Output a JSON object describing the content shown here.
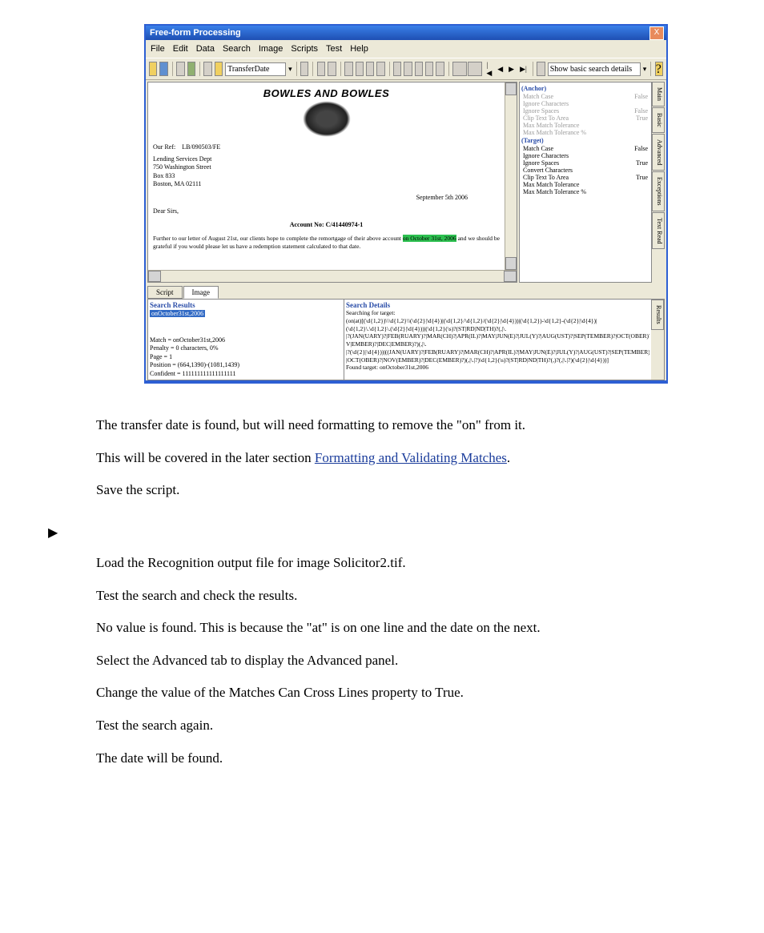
{
  "window": {
    "title": "Free-form Processing",
    "close": "X"
  },
  "menu": [
    "File",
    "Edit",
    "Data",
    "Search",
    "Image",
    "Scripts",
    "Test",
    "Help"
  ],
  "toolbar": {
    "field": "TransferDate",
    "showDetail": "Show basic search details"
  },
  "doc": {
    "company": "BOWLES AND BOWLES",
    "ourref_label": "Our Ref:",
    "ourref": "LB/090503/FE",
    "addr1": "Lending Services Dept",
    "addr2": "750 Washington Street",
    "addr3": "Box 833",
    "addr4": "Boston, MA 02111",
    "date": "September 5th 2006",
    "dear": "Dear Sirs,",
    "acct": "Account No:  C/41440974-1",
    "para_pre": "Further to our letter of August 21st, our clients hope to complete the remortgage of their above account ",
    "para_hl": "on October 31st, 2006",
    "para_post": " and we should be grateful if you would please let us have a redemption statement calculated to that date."
  },
  "props": {
    "grp1": "(Anchor)",
    "rows1": [
      {
        "k": "Match Case",
        "v": "False"
      },
      {
        "k": "Ignore Characters",
        "v": ""
      },
      {
        "k": "Ignore Spaces",
        "v": "False"
      },
      {
        "k": "Clip Text To Area",
        "v": "True"
      },
      {
        "k": "Max Match Tolerance",
        "v": ""
      },
      {
        "k": "Max Match Tolerance %",
        "v": ""
      }
    ],
    "grp2": "(Target)",
    "rows2": [
      {
        "k": "Match Case",
        "v": "False"
      },
      {
        "k": "Ignore Characters",
        "v": ""
      },
      {
        "k": "Ignore Spaces",
        "v": "True"
      },
      {
        "k": "Convert Characters",
        "v": ""
      },
      {
        "k": "Clip Text To Area",
        "v": "True"
      },
      {
        "k": "Max Match Tolerance",
        "v": ""
      },
      {
        "k": "Max Match Tolerance %",
        "v": ""
      }
    ]
  },
  "sidetabs": [
    "Main",
    "Basic",
    "Advanced",
    "Exceptions",
    "Text Read"
  ],
  "lowtabs": [
    "Script",
    "Image"
  ],
  "results": {
    "head": "Search Results",
    "sel": "onOctober31st,2006",
    "stats": [
      "Match = onOctober31st,2006",
      "Penalty = 0 characters, 0%",
      "Page = 1",
      "Position = (664,1390)-(1081,1439)",
      "Confident = 111111111111111111"
    ]
  },
  "details": {
    "head": "Search Details",
    "lines": [
      "Searching for target:",
      "(on|at)[(\\d{1,2})\\\\\\d{1,2}\\\\(\\d{2}|\\d{4})|(\\d{1,2}/\\d{1,2}/(\\d{2}|\\d{4}))|(\\d{1,2})-\\d{1,2}-(\\d{2}|\\d{4})|",
      "(\\d{1,2}\\.\\d{1,2}\\.(\\d{2}|\\d{4}))|(\\d{1,2}(\\s)?(ST|RD|ND|TH)?(,|\\.",
      "|?(JAN(UARY)?|FEB(RUARY)?|MAR(CH)?|APR(IL)?|MAY|JUN(E)?|JUL(Y)?|AUG(UST)?|SEP(TEMBER)?|OCT(OBER)?|N...",
      "V|EMBER)?|DEC|EMBER)?)(,|\\.",
      "|?(\\d{2}|\\d{4}))|((JAN(UARY)?|FEB(RUARY)?|MAR(CH)?|APR(IL)?|MAY|JUN(E)?|JUL(Y)?|AUG(UST)?|SEP(TEMBER)?",
      "|OCT(OBER)?|NOV(EMBER)?|DEC(EMBER)?)(,|\\.|?)\\d{1,2}(\\s)?(ST|RD|ND|TH)?(,)?(,|\\.|?)(\\d{2}|\\d{4}))]",
      "Found target: onOctober31st,2006"
    ]
  },
  "rtab": "Results",
  "body": {
    "p1a": "The transfer date is found, but will need formatting to remove the \"on\" from it.",
    "p2a": "This will be covered in the later section ",
    "p2link": "Formatting and Validating Matches",
    "p2b": ".",
    "p3": "Save the script.",
    "arrow": "▶",
    "p4": "Load the Recognition output file for image Solicitor2.tif.",
    "p5": "Test the search and check the results.",
    "p6": "No value is found. This is because the \"at\" is on one line and the date on the next.",
    "p7": "Select the Advanced tab to display the Advanced panel.",
    "p8": "Change the value of the Matches Can Cross Lines property to True.",
    "p9": "Test the search again.",
    "p10": "The date will be found."
  }
}
